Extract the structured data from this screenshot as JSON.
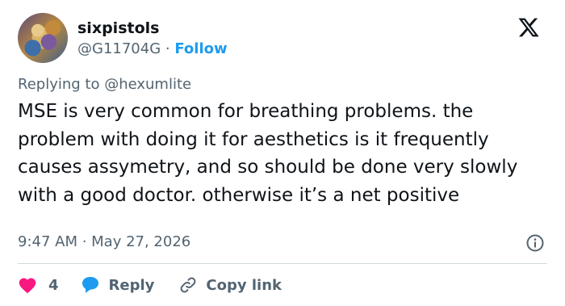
{
  "author": {
    "display_name": "sixpistols",
    "handle": "@G11704G",
    "separator": " · ",
    "follow_label": "Follow"
  },
  "reply_context": {
    "prefix": "Replying to ",
    "mention": "@hexumlite"
  },
  "tweet": {
    "text": "MSE is very common for breathing problems. the problem with doing it for aesthetics is it frequently causes assymetry, and so should be done very slowly with a good doctor. otherwise it’s a net positive",
    "timestamp": "9:47 AM · May 27, 2026"
  },
  "actions": {
    "like_count": "4",
    "reply_label": "Reply",
    "copy_link_label": "Copy link"
  },
  "icons": {
    "brand": "x-logo-icon",
    "info": "info-icon",
    "like": "heart-icon",
    "reply": "speech-bubble-icon",
    "copy": "link-icon"
  },
  "colors": {
    "accent": "#1d9bf0",
    "heart": "#f91880",
    "text": "#0f1419",
    "muted": "#536471"
  }
}
